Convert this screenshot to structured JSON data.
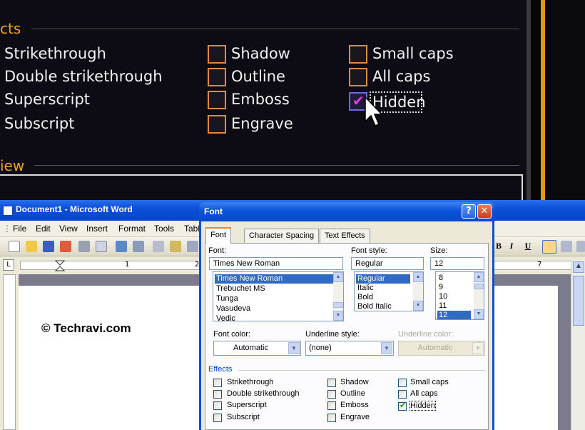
{
  "zoom": {
    "effects_label": "cts",
    "preview_label": "iew",
    "col1": [
      "Strikethrough",
      "Double strikethrough",
      "Superscript",
      "Subscript"
    ],
    "col2": [
      "Shadow",
      "Outline",
      "Emboss",
      "Engrave"
    ],
    "col3": [
      "Small caps",
      "All caps",
      "Hidden"
    ]
  },
  "word": {
    "title": "Document1 - Microsoft Word",
    "menu": [
      "File",
      "Edit",
      "View",
      "Insert",
      "Format",
      "Tools",
      "Tabl"
    ],
    "ruler_marks": [
      "1",
      "2",
      "7"
    ],
    "doc_text": "© Techravi.com",
    "format_buttons": [
      "I",
      "U"
    ]
  },
  "dialog": {
    "title": "Font",
    "help_glyph": "?",
    "close_glyph": "✕",
    "tabs": [
      "Font",
      "Character Spacing",
      "Text Effects"
    ],
    "font": {
      "label": "Font:",
      "value": "Times New Roman",
      "items": [
        "Times New Roman",
        "Trebuchet MS",
        "Tunga",
        "Vasudeva",
        "Vedic"
      ],
      "selected": "Times New Roman"
    },
    "style": {
      "label": "Font style:",
      "value": "Regular",
      "items": [
        "Regular",
        "Italic",
        "Bold",
        "Bold Italic"
      ],
      "selected": "Regular"
    },
    "size": {
      "label": "Size:",
      "value": "12",
      "items": [
        "8",
        "9",
        "10",
        "11",
        "12"
      ],
      "selected": "12"
    },
    "font_color": {
      "label": "Font color:",
      "value": "Automatic"
    },
    "underline_style": {
      "label": "Underline style:",
      "value": "(none)"
    },
    "underline_color": {
      "label": "Underline color:",
      "value": "Automatic",
      "disabled": true
    },
    "effects": {
      "label": "Effects",
      "col1": [
        {
          "label": "Strikethrough",
          "checked": false
        },
        {
          "label": "Double strikethrough",
          "checked": false
        },
        {
          "label": "Superscript",
          "checked": false
        },
        {
          "label": "Subscript",
          "checked": false
        }
      ],
      "col2": [
        {
          "label": "Shadow",
          "checked": false
        },
        {
          "label": "Outline",
          "checked": false
        },
        {
          "label": "Emboss",
          "checked": false
        },
        {
          "label": "Engrave",
          "checked": false
        }
      ],
      "col3": [
        {
          "label": "Small caps",
          "checked": false
        },
        {
          "label": "All caps",
          "checked": false
        },
        {
          "label": "Hidden",
          "checked": true
        }
      ]
    }
  },
  "colors": {
    "xp_blue": "#0a50d8",
    "dialog_face": "#ece9d8",
    "selection": "#316ac5",
    "zoom_accent": "#f0a020",
    "check_green": "#21a121"
  }
}
